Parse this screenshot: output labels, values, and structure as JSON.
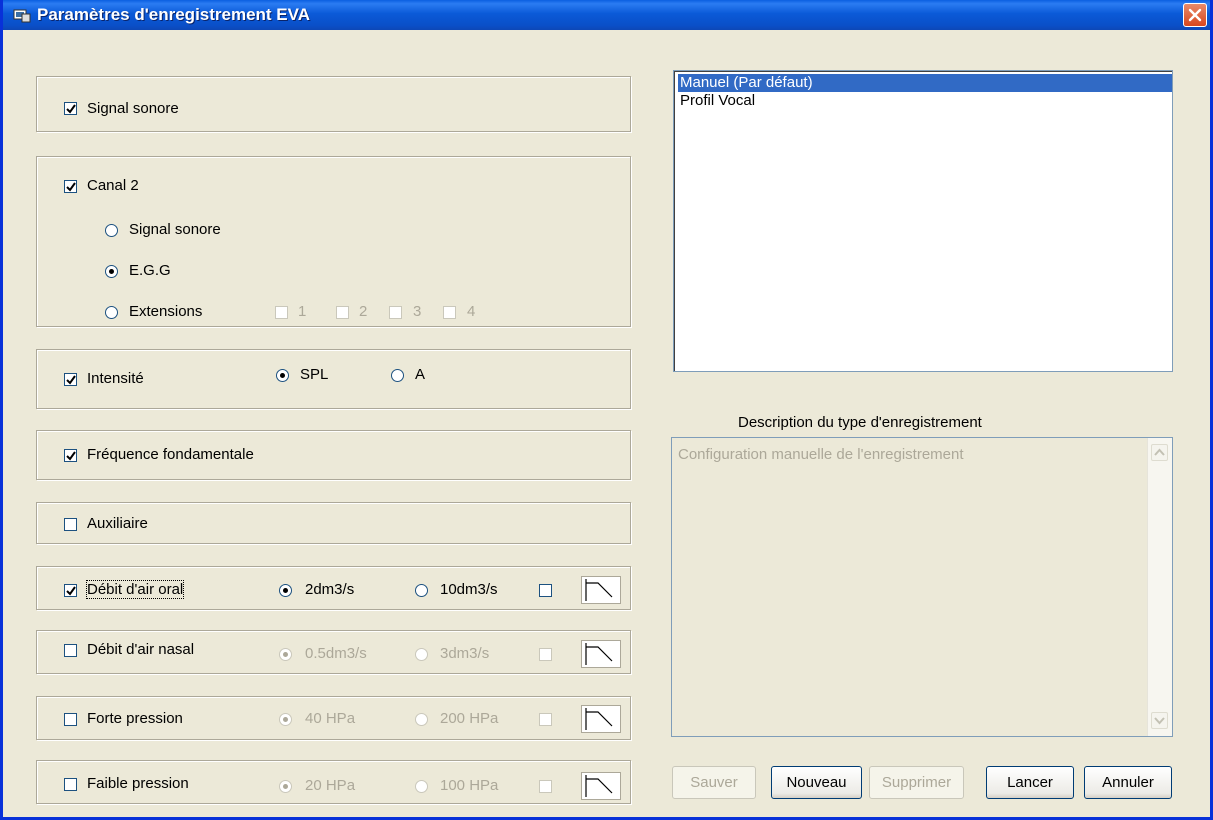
{
  "window": {
    "title": "Paramètres d'enregistrement EVA",
    "close_icon": "close-icon"
  },
  "groups": {
    "signal_sonore": {
      "label": "Signal sonore",
      "checked": true
    },
    "canal2": {
      "label": "Canal 2",
      "checked": true,
      "options": [
        "Signal sonore",
        "E.G.G",
        "Extensions"
      ],
      "selected": "E.G.G",
      "extensions": [
        "1",
        "2",
        "3",
        "4"
      ]
    },
    "intensite": {
      "label": "Intensité",
      "checked": true,
      "options": [
        "SPL",
        "A"
      ],
      "selected": "SPL"
    },
    "frequence": {
      "label": "Fréquence fondamentale",
      "checked": true
    },
    "auxiliaire": {
      "label": "Auxiliaire",
      "checked": false
    },
    "debit_oral": {
      "label": "Débit d'air oral",
      "checked": true,
      "options": [
        "2dm3/s",
        "10dm3/s"
      ],
      "selected": "2dm3/s"
    },
    "debit_nasal": {
      "label": "Débit d'air nasal",
      "checked": false,
      "options": [
        "0.5dm3/s",
        "3dm3/s"
      ],
      "selected": "0.5dm3/s"
    },
    "forte_pression": {
      "label": "Forte pression",
      "checked": false,
      "options": [
        "40 HPa",
        "200 HPa"
      ],
      "selected": "40 HPa"
    },
    "faible_pression": {
      "label": "Faible pression",
      "checked": false,
      "options": [
        "20 HPa",
        "100 HPa"
      ],
      "selected": "20 HPa"
    }
  },
  "profiles": {
    "items": [
      "Manuel (Par défaut)",
      "Profil Vocal"
    ],
    "selected": "Manuel (Par défaut)"
  },
  "description": {
    "label": "Description du type d'enregistrement",
    "text": "Configuration manuelle de l'enregistrement"
  },
  "buttons": {
    "save": "Sauver",
    "new": "Nouveau",
    "delete": "Supprimer",
    "launch": "Lancer",
    "cancel": "Annuler"
  },
  "colors": {
    "titlebar": "#0a5fe0",
    "selection": "#316ac5",
    "dialog_bg": "#ece9d8"
  }
}
